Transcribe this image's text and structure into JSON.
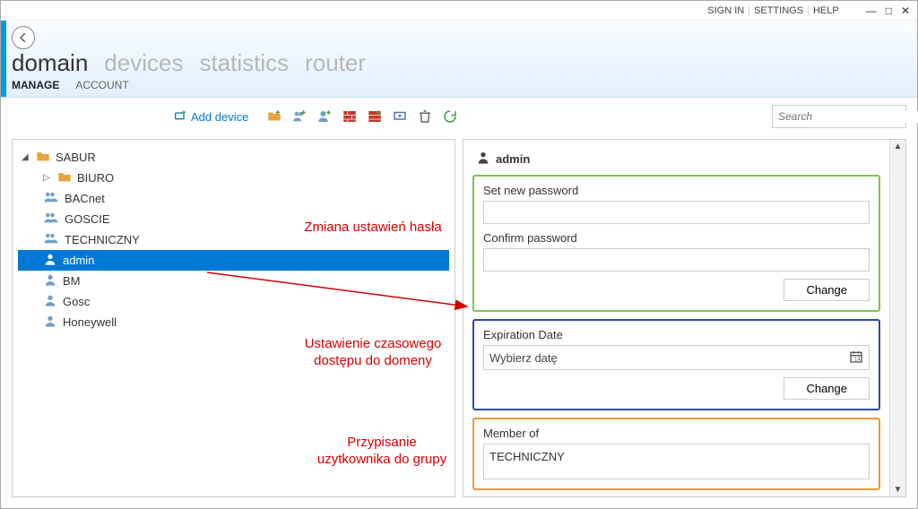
{
  "titlebar": {
    "signin": "SIGN IN",
    "settings": "SETTINGS",
    "help": "HELP"
  },
  "nav": {
    "tabs": [
      "domain",
      "devices",
      "statistics",
      "router"
    ],
    "subtabs": [
      "MANAGE",
      "ACCOUNT"
    ]
  },
  "toolbar": {
    "add_device": "Add device",
    "search_placeholder": "Search"
  },
  "tree": {
    "root": "SABUR",
    "items": [
      {
        "label": "BIURO",
        "type": "folder"
      },
      {
        "label": "BACnet",
        "type": "group"
      },
      {
        "label": "GOSCIE",
        "type": "group"
      },
      {
        "label": "TECHNICZNY",
        "type": "group"
      },
      {
        "label": "admin",
        "type": "user",
        "selected": true
      },
      {
        "label": "BM",
        "type": "user"
      },
      {
        "label": "Gosc",
        "type": "user"
      },
      {
        "label": "Honeywell",
        "type": "user"
      }
    ]
  },
  "detail": {
    "title": "admin",
    "password": {
      "set_label": "Set new password",
      "confirm_label": "Confirm password",
      "change_btn": "Change"
    },
    "expiration": {
      "label": "Expiration Date",
      "picker_text": "Wybierz datę",
      "change_btn": "Change"
    },
    "member": {
      "label": "Member of",
      "value": "TECHNICZNY"
    }
  },
  "annotations": {
    "pwd": "Zmiana ustawień hasła",
    "exp": "Ustawienie czasowego dostępu do domeny",
    "grp": "Przypisanie uzytkownika do grupy"
  }
}
